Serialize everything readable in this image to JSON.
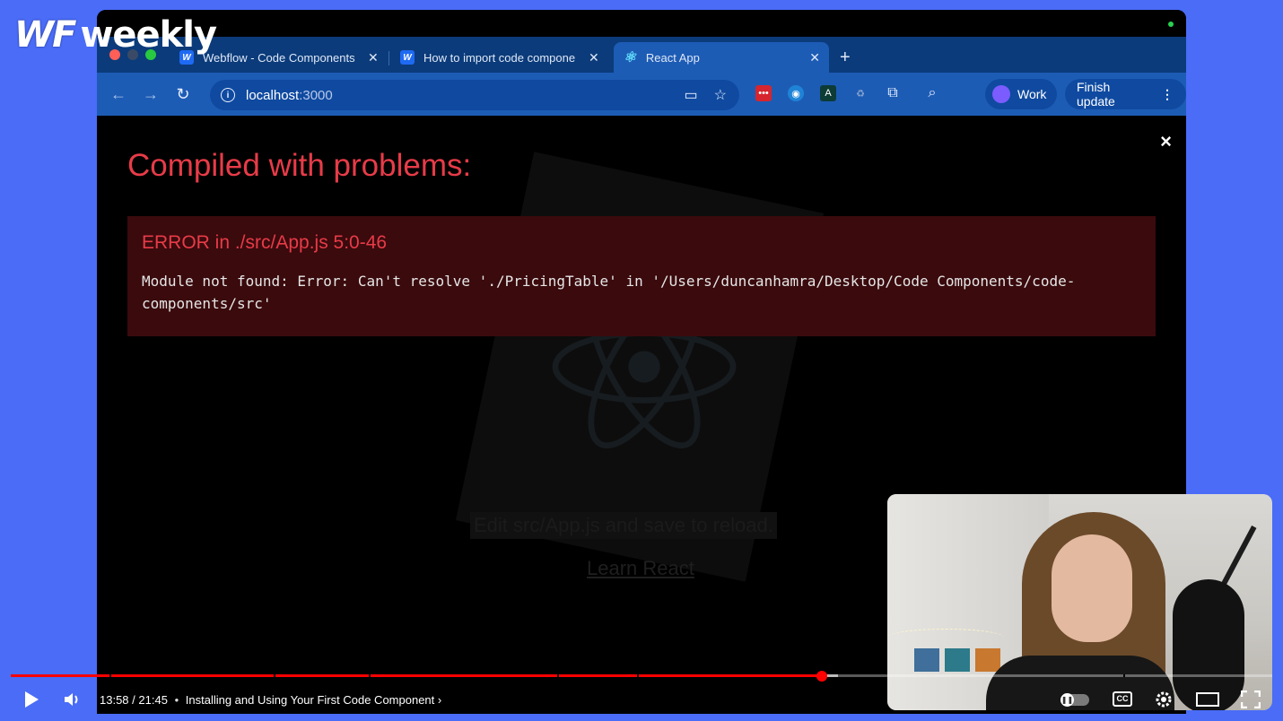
{
  "logo": {
    "wf": "WF",
    "weekly": "weekly"
  },
  "browser": {
    "tabs": [
      {
        "label": "Webflow - Code Components",
        "favicon": "W"
      },
      {
        "label": "How to import code compone",
        "favicon": "W"
      },
      {
        "label": "React App",
        "favicon": "⚛"
      }
    ],
    "new_tab": "+",
    "close_glyph": "✕",
    "address": {
      "host": "localhost",
      "port": ":3000"
    },
    "profile": "Work",
    "finish_update": "Finish update"
  },
  "overlay": {
    "title": "Compiled with problems:",
    "close": "×",
    "error_heading": "ERROR in ./src/App.js 5:0-46",
    "error_message": "Module not found: Error: Can't resolve './PricingTable' in '/Users/duncanhamra/Desktop/Code Components/code-components/src'"
  },
  "background_app": {
    "edit_hint": "Edit src/App.js and save to reload.",
    "learn_link": "Learn React"
  },
  "player": {
    "current_time": "13:58",
    "duration": "21:45",
    "chapter": "Installing and Using Your First Code Component",
    "progress_fraction": 0.643,
    "accent": "#ff0000"
  }
}
